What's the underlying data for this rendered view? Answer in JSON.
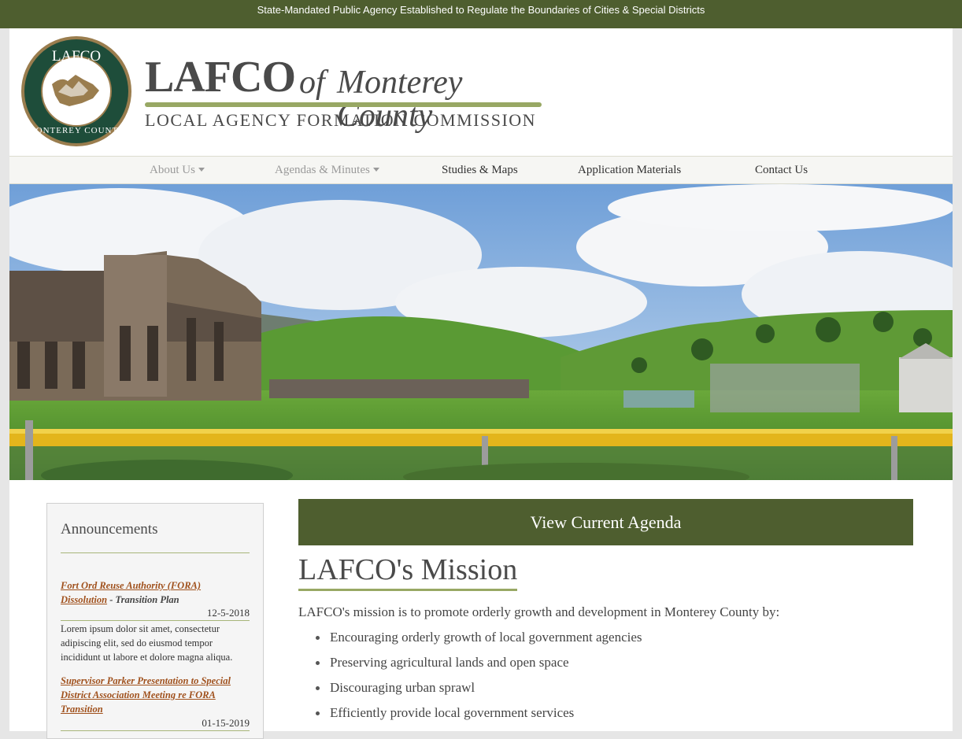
{
  "topbar": {
    "text": "State-Mandated Public Agency Established to Regulate the Boundaries of Cities & Special Districts"
  },
  "logo": {
    "seal_top_text": "LAFCO",
    "seal_bottom_text": "MONTEREY COUNTY",
    "wordmark_main": "LAFCO",
    "wordmark_of": "of",
    "wordmark_county": "Monterey County",
    "wordmark_sub": "LOCAL AGENCY FORMATION COMMISSION"
  },
  "nav": {
    "items": [
      {
        "label": "About Us",
        "has_dropdown": true
      },
      {
        "label": "Agendas & Minutes",
        "has_dropdown": true
      },
      {
        "label": "Studies & Maps",
        "has_dropdown": false
      },
      {
        "label": "Application Materials",
        "has_dropdown": false
      },
      {
        "label": "Contact Us",
        "has_dropdown": false
      }
    ]
  },
  "sidebar": {
    "title": "Announcements",
    "items": [
      {
        "link": "Fort Ord Reuse Authority (FORA) Dissolution",
        "suffix": " - Transition Plan",
        "date": "12-5-2018",
        "body": "Lorem ipsum dolor sit amet, consectetur adipiscing elit, sed do eiusmod tempor incididunt ut labore et dolore magna aliqua."
      },
      {
        "link": "Supervisor Parker Presentation to Special District Association Meeting re FORA Transition",
        "date": "01-15-2019"
      }
    ]
  },
  "main": {
    "agenda_button": "View Current Agenda",
    "mission_title": "LAFCO's Mission",
    "mission_intro": "LAFCO's mission is to promote orderly growth and development in Monterey County by:",
    "mission_points": [
      "Encouraging orderly growth of local government agencies",
      "Preserving agricultural lands and open space",
      "Discouraging urban sprawl",
      "Efficiently provide local government services"
    ]
  },
  "colors": {
    "brand_green": "#4e5e2f",
    "accent_olive": "#98a864",
    "link_brown": "#a0511d",
    "seal_green": "#1e4d3a",
    "seal_gold": "#9a7d4e"
  }
}
